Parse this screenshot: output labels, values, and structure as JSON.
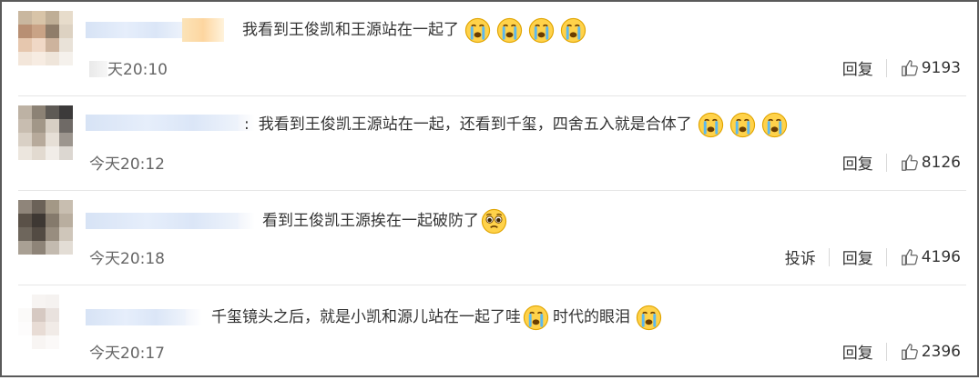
{
  "comments": [
    {
      "text": "我看到王俊凯和王源站在一起了",
      "emojis": [
        "crying-face-icon",
        "crying-face-icon",
        "crying-face-icon",
        "crying-face-icon"
      ],
      "time": "天20:10",
      "actions": [
        "回复"
      ],
      "likes": "9193"
    },
    {
      "colon": ":",
      "text": "我看到王俊凯王源站在一起，还看到千玺，四舍五入就是合体了",
      "emojis": [
        "crying-face-icon",
        "crying-face-icon",
        "crying-face-icon"
      ],
      "time": "今天20:12",
      "actions": [
        "回复"
      ],
      "likes": "8126"
    },
    {
      "text": "看到王俊凯王源挨在一起破防了",
      "emojis": [
        "pleading-face-icon"
      ],
      "time": "今天20:18",
      "actions": [
        "投诉",
        "回复"
      ],
      "likes": "4196"
    },
    {
      "text_a": "千玺镜头之后，就是小凯和源儿站在一起了哇",
      "text_b": "时代的眼泪",
      "emojis": [
        "crying-face-icon",
        "crying-face-icon"
      ],
      "time": "今天20:17",
      "actions": [
        "回复"
      ],
      "likes": "2396"
    }
  ]
}
